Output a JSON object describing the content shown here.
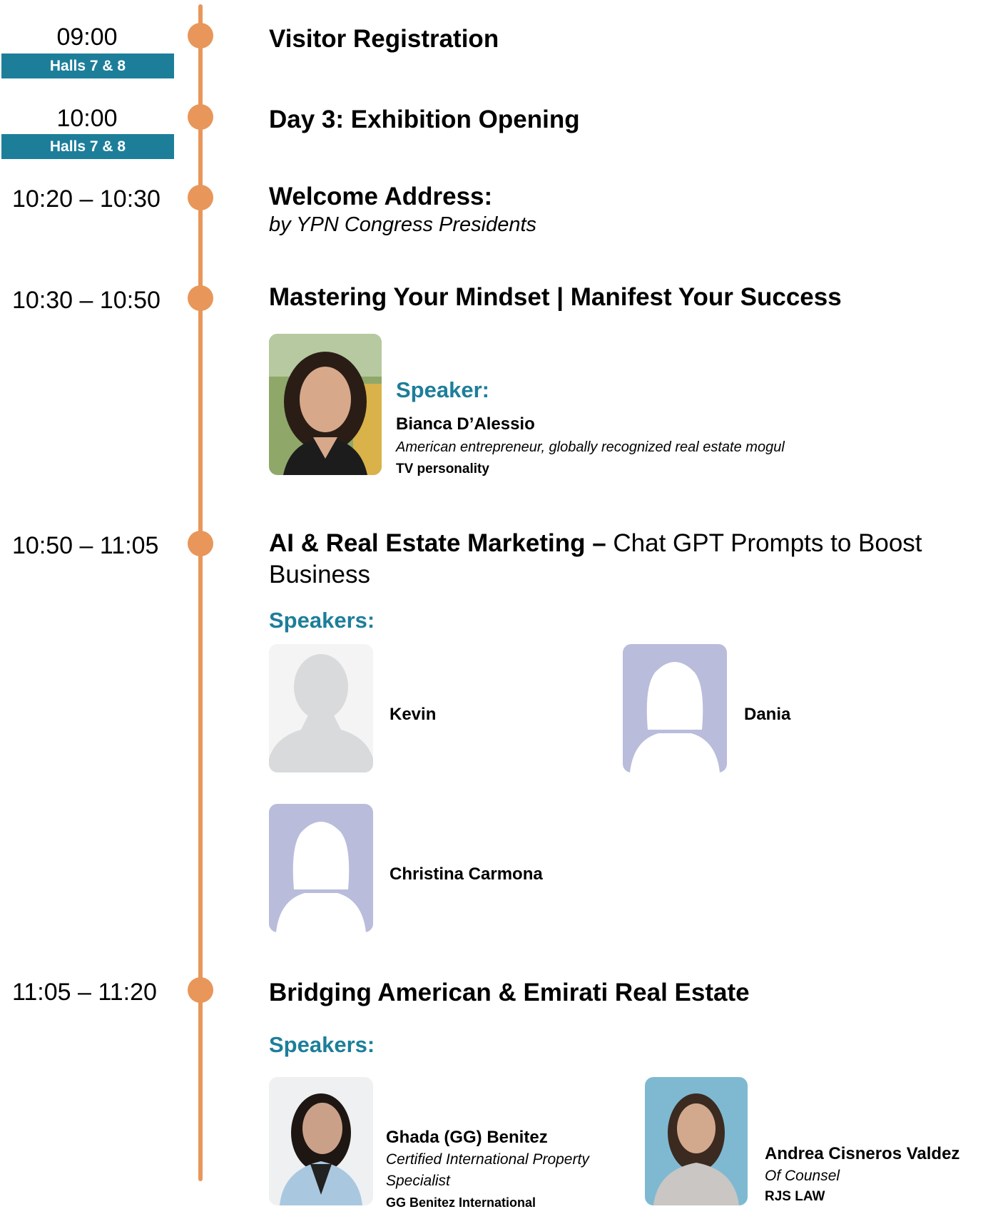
{
  "schedule": [
    {
      "time": "09:00",
      "hall": "Halls 7 & 8",
      "title": "Visitor Registration"
    },
    {
      "time": "10:00",
      "hall": "Halls 7 & 8",
      "title": "Day 3: Exhibition Opening"
    },
    {
      "time": "10:20 – 10:30",
      "title": "Welcome Address:",
      "subtitle": "by YPN Congress Presidents"
    },
    {
      "time": "10:30 – 10:50",
      "title": "Mastering Your Mindset | Manifest Your Success",
      "speakers_heading": "Speaker:",
      "speakers": [
        {
          "name": "Bianca D’Alessio",
          "role": "American entrepreneur, globally recognized real estate mogul",
          "org": "TV personality"
        }
      ]
    },
    {
      "time": "10:50 – 11:05",
      "title_bold": "AI & Real Estate Marketing –",
      "title_rest": "Chat GPT Prompts to Boost",
      "title_line2": "Business",
      "speakers_heading": "Speakers:",
      "speakers": [
        {
          "name": "Kevin"
        },
        {
          "name": "Dania"
        },
        {
          "name": "Christina Carmona"
        }
      ]
    },
    {
      "time": "11:05 – 11:20",
      "title": "Bridging American & Emirati Real Estate",
      "speakers_heading": "Speakers:",
      "speakers": [
        {
          "name": "Ghada (GG) Benitez",
          "role_line1": "Certified International Property",
          "role_line2": "Specialist",
          "org": "GG Benitez International"
        },
        {
          "name": "Andrea Cisneros Valdez",
          "role": "Of Counsel",
          "org": "RJS LAW"
        }
      ]
    }
  ],
  "colors": {
    "accent": "#1d7e9a",
    "timeline": "#e8965a",
    "placeholder_male": "#d9dadc",
    "placeholder_female_bg": "#b9bcdb"
  }
}
